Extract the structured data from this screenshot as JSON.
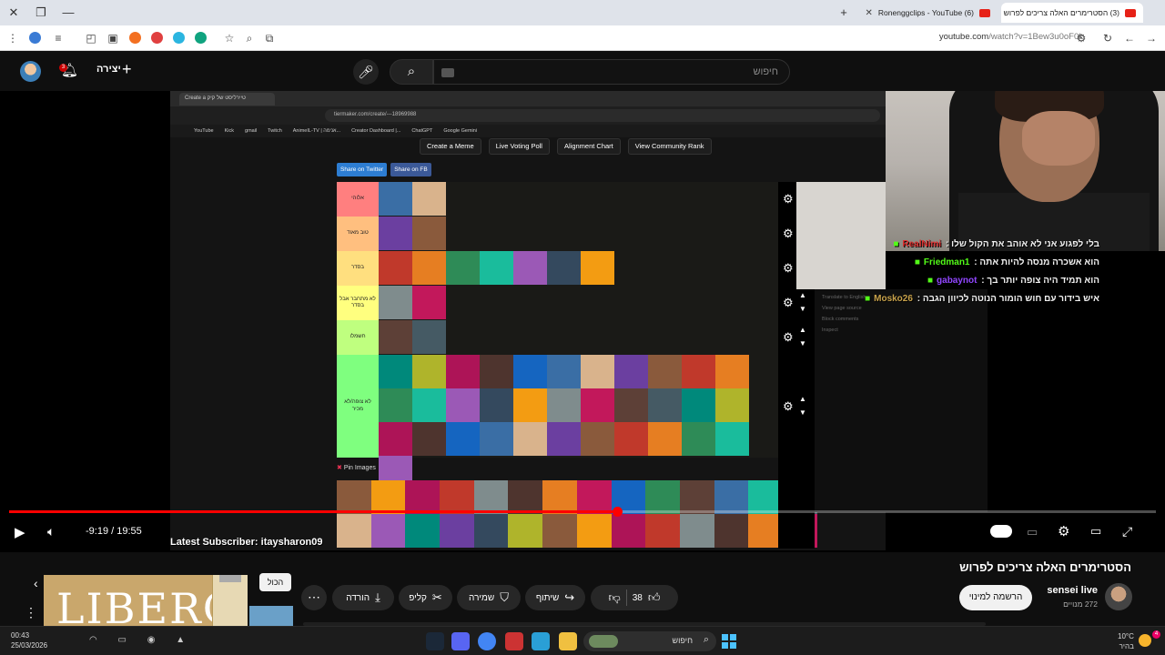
{
  "browser": {
    "tabs": [
      {
        "label": "(3) הסטרימרים האלה צריכים לפרוש",
        "active": true
      },
      {
        "label": "(6) Ronenggclips - YouTube",
        "active": false
      }
    ],
    "url_domain": "youtube.com",
    "url_path": "/watch?v=1Bew3u0oF0k"
  },
  "header": {
    "notification_count": "3",
    "create_label": "יצירה",
    "search_placeholder": "חיפוש"
  },
  "inner_browser": {
    "tab_title": "Create a טיירליסט של קיק",
    "url": "tiermaker.com/create/---18969988",
    "bookmarks": [
      "YouTube",
      "Kick",
      "gmail",
      "Twitch",
      "AnimeIL-TV | אנימה...",
      "Creator Dashboard |...",
      "ChatGPT",
      "Google Gemini"
    ],
    "buttons": [
      "Create a Meme",
      "Live Voting Poll",
      "Alignment Chart",
      "View Community Rank"
    ],
    "share_twitter": "Share on Twitter",
    "share_fb": "Share on FB",
    "tiers": [
      {
        "label": "אלוהי",
        "color": "#ff7f7f",
        "count": 2
      },
      {
        "label": "טוב מאוד",
        "color": "#ffbf7f",
        "count": 2
      },
      {
        "label": "בסדר",
        "color": "#ffdf7f",
        "count": 7
      },
      {
        "label": "לא מתחבר אבל בסדר",
        "color": "#ffff7f",
        "count": 2
      },
      {
        "label": "חשמלו",
        "color": "#bfff7f",
        "count": 2
      },
      {
        "label": "לא צופה/לא מכיר",
        "color": "#7fff7f",
        "count": 34
      }
    ],
    "pin_title": "Pin Images",
    "chat_menu": [
      "Translate to English",
      "View page source",
      "Block comments",
      "Inspect"
    ]
  },
  "chat": [
    {
      "user": "RealNimi",
      "user_color": "#e0302f",
      "text": "בלי לפגוע אני לא אוהב את הקול שלו"
    },
    {
      "user": "Friedman1",
      "user_color": "#53fc18",
      "text": "הוא אשכרה מנסה להיות אתה"
    },
    {
      "user": "gabaynot",
      "user_color": "#9146ff",
      "text": "הוא תמיד היה צופה יותר בך"
    },
    {
      "user": "Mosko26",
      "user_color": "#c8a24b",
      "text": "איש בידור עם חוש הומור הנוטה לכיוון הגבה"
    }
  ],
  "player": {
    "time": "-9:19 / 19:55",
    "progress": 0.53,
    "latest_subscriber": "Latest Subscriber: itaysharon09"
  },
  "video": {
    "title": "הסטרימרים האלה צריכים לפרוש",
    "channel": "sensei live",
    "subscribers": "272 מנויים",
    "subscribe_label": "הרשמה למינוי",
    "likes": "38",
    "share_label": "שיתוף",
    "save_label": "שמירה",
    "clip_label": "קליפ",
    "download_label": "הורדה",
    "tooltip": "הכול",
    "ad_word": "LIBERO"
  },
  "taskbar": {
    "time": "00:43",
    "date": "25/03/2026",
    "search_label": "חיפוש",
    "temperature": "10°C",
    "weather_label": "בהיר",
    "notification": "4"
  }
}
